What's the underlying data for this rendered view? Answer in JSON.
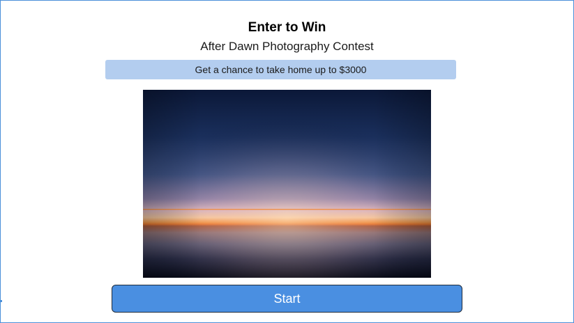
{
  "header": {
    "title": "Enter to Win",
    "subtitle": "After Dawn Photography Contest"
  },
  "banner": {
    "text": "Get a chance to take home up to $3000",
    "color": "#b3cdef"
  },
  "photo": {
    "subject": "dawn horizon over calm water"
  },
  "actions": {
    "start_label": "Start",
    "button_color": "#4a8fe1"
  },
  "theme": {
    "frame_border": "#4a8fd9"
  }
}
